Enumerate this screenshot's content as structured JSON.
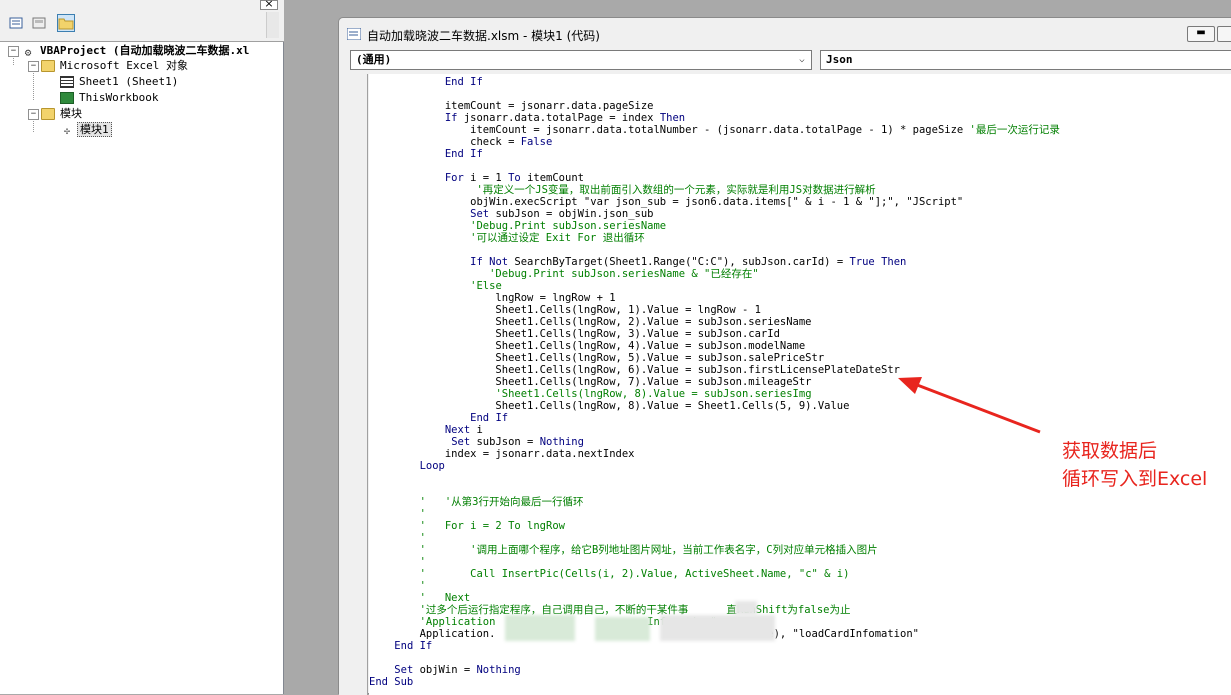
{
  "project_panel": {
    "tree": [
      {
        "label": "VBAProject (自动加载晓波二车数据.xl",
        "icon": "vba-project-icon",
        "expander": "−"
      },
      {
        "label": "Microsoft Excel 对象",
        "icon": "folder-icon",
        "expander": "−"
      },
      {
        "label": "Sheet1 (Sheet1)",
        "icon": "worksheet-icon",
        "expander": ""
      },
      {
        "label": "ThisWorkbook",
        "icon": "workbook-icon",
        "expander": ""
      },
      {
        "label": "模块",
        "icon": "folder-icon",
        "expander": "−"
      },
      {
        "label": "模块1",
        "icon": "module-icon",
        "expander": ""
      }
    ]
  },
  "code_window": {
    "title": "自动加载晓波二车数据.xlsm - 模块1 (代码)",
    "object_combo": "(通用)",
    "procedure_combo": "Json"
  },
  "code_lines": [
    [
      {
        "t": "            "
      },
      {
        "t": "End If",
        "k": 1
      }
    ],
    [
      {
        "t": ""
      }
    ],
    [
      {
        "t": "            itemCount = jsonarr.data.pageSize"
      }
    ],
    [
      {
        "t": "            "
      },
      {
        "t": "If",
        "k": 1
      },
      {
        "t": " jsonarr.data.totalPage = index "
      },
      {
        "t": "Then",
        "k": 1
      }
    ],
    [
      {
        "t": "                itemCount = jsonarr.data.totalNumber - (jsonarr.data.totalPage - 1) * pageSize "
      },
      {
        "t": "'最后一次运行记录",
        "c": 1
      }
    ],
    [
      {
        "t": "                check = "
      },
      {
        "t": "False",
        "k": 1
      }
    ],
    [
      {
        "t": "            "
      },
      {
        "t": "End If",
        "k": 1
      }
    ],
    [
      {
        "t": ""
      }
    ],
    [
      {
        "t": "            "
      },
      {
        "t": "For",
        "k": 1
      },
      {
        "t": " i = 1 "
      },
      {
        "t": "To",
        "k": 1
      },
      {
        "t": " itemCount"
      }
    ],
    [
      {
        "t": "                 "
      },
      {
        "t": "'再定义一个JS变量，取出前面引入数组的一个元素，实际就是利用JS对数据进行解析",
        "c": 1
      }
    ],
    [
      {
        "t": "                objWin.execScript \"var json_sub = json6.data.items[\" & i - 1 & \"];\", \"JScript\""
      }
    ],
    [
      {
        "t": "                "
      },
      {
        "t": "Set",
        "k": 1
      },
      {
        "t": " subJson = objWin.json_sub"
      }
    ],
    [
      {
        "t": "                "
      },
      {
        "t": "'Debug.Print subJson.seriesName",
        "c": 1
      }
    ],
    [
      {
        "t": "                "
      },
      {
        "t": "'可以通过设定 Exit For 退出循环",
        "c": 1
      }
    ],
    [
      {
        "t": ""
      }
    ],
    [
      {
        "t": "                "
      },
      {
        "t": "If Not",
        "k": 1
      },
      {
        "t": " SearchByTarget(Sheet1.Range(\"C:C\"), subJson.carId) = "
      },
      {
        "t": "True Then",
        "k": 1
      }
    ],
    [
      {
        "t": "                   "
      },
      {
        "t": "'Debug.Print subJson.seriesName & \"已经存在\"",
        "c": 1
      }
    ],
    [
      {
        "t": "                "
      },
      {
        "t": "'Else",
        "c": 1
      }
    ],
    [
      {
        "t": "                    lngRow = lngRow + 1"
      }
    ],
    [
      {
        "t": "                    Sheet1.Cells(lngRow, 1).Value = lngRow - 1"
      }
    ],
    [
      {
        "t": "                    Sheet1.Cells(lngRow, 2).Value = subJson.seriesName"
      }
    ],
    [
      {
        "t": "                    Sheet1.Cells(lngRow, 3).Value = subJson.carId"
      }
    ],
    [
      {
        "t": "                    Sheet1.Cells(lngRow, 4).Value = subJson.modelName"
      }
    ],
    [
      {
        "t": "                    Sheet1.Cells(lngRow, 5).Value = subJson.salePriceStr"
      }
    ],
    [
      {
        "t": "                    Sheet1.Cells(lngRow, 6).Value = subJson.firstLicensePlateDateStr"
      }
    ],
    [
      {
        "t": "                    Sheet1.Cells(lngRow, 7).Value = subJson.mileageStr"
      }
    ],
    [
      {
        "t": "                    "
      },
      {
        "t": "'Sheet1.Cells(lngRow, 8).Value = subJson.seriesImg",
        "c": 1
      }
    ],
    [
      {
        "t": "                    Sheet1.Cells(lngRow, 8).Value = Sheet1.Cells(5, 9).Value"
      }
    ],
    [
      {
        "t": "                "
      },
      {
        "t": "End If",
        "k": 1
      }
    ],
    [
      {
        "t": "            "
      },
      {
        "t": "Next",
        "k": 1
      },
      {
        "t": " i"
      }
    ],
    [
      {
        "t": "             "
      },
      {
        "t": "Set",
        "k": 1
      },
      {
        "t": " subJson = "
      },
      {
        "t": "Nothing",
        "k": 1
      }
    ],
    [
      {
        "t": "            index = jsonarr.data.nextIndex"
      }
    ],
    [
      {
        "t": "        "
      },
      {
        "t": "Loop",
        "k": 1
      }
    ],
    [
      {
        "t": ""
      }
    ],
    [
      {
        "t": ""
      }
    ],
    [
      {
        "t": "        ",
        "c": 0
      },
      {
        "t": "'   '从第3行开始向最后一行循环",
        "c": 1
      }
    ],
    [
      {
        "t": "        "
      },
      {
        "t": "'",
        "c": 1
      }
    ],
    [
      {
        "t": "        "
      },
      {
        "t": "'   For i = 2 To lngRow",
        "c": 1
      }
    ],
    [
      {
        "t": "        "
      },
      {
        "t": "'",
        "c": 1
      }
    ],
    [
      {
        "t": "        "
      },
      {
        "t": "'       '调用上面哪个程序，给它B列地址图片网址，当前工作表名字，C列对应单元格插入图片",
        "c": 1
      }
    ],
    [
      {
        "t": "        "
      },
      {
        "t": "'",
        "c": 1
      }
    ],
    [
      {
        "t": "        "
      },
      {
        "t": "'       Call InsertPic(Cells(i, 2).Value, ActiveSheet.Name, \"c\" & i)",
        "c": 1
      }
    ],
    [
      {
        "t": "        "
      },
      {
        "t": "'",
        "c": 1
      }
    ],
    [
      {
        "t": "        "
      },
      {
        "t": "'   Next",
        "c": 1
      }
    ],
    [
      {
        "t": "        "
      },
      {
        "t": "'过多个后运行指定程序，自己调用自己，不断的干某件事      直RunShift为false为止",
        "c": 1
      }
    ],
    [
      {
        "t": "        "
      },
      {
        "t": "'Application                        Infomation\"",
        "c": 1
      }
    ],
    [
      {
        "t": "        Application.                                           e), \"loadCardInfomation\""
      }
    ],
    [
      {
        "t": "    "
      },
      {
        "t": "End If",
        "k": 1
      }
    ],
    [
      {
        "t": ""
      }
    ],
    [
      {
        "t": "    "
      },
      {
        "t": "Set",
        "k": 1
      },
      {
        "t": " objWin = "
      },
      {
        "t": "Nothing",
        "k": 1
      }
    ],
    [
      {
        "t": "End Sub",
        "k": 1
      }
    ]
  ],
  "annotation": {
    "line1": "获取数据后",
    "line2": "循环写入到Excel",
    "color": "#e8251e"
  }
}
